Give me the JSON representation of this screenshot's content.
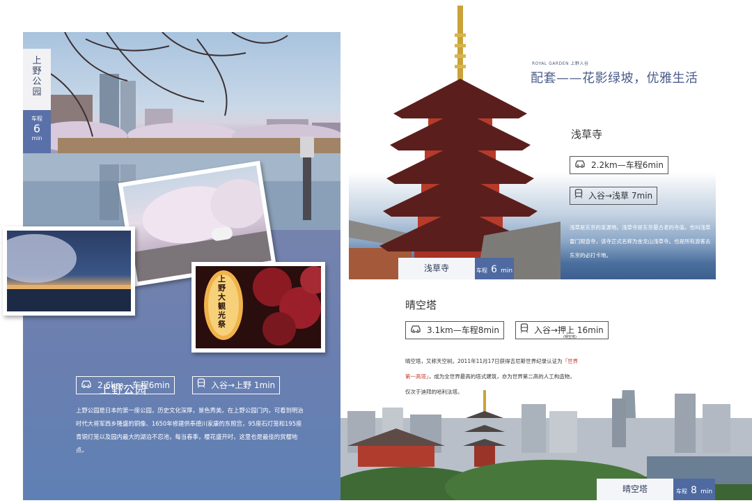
{
  "ueno": {
    "tab_name_chars": [
      "上",
      "野",
      "公",
      "园"
    ],
    "tab_time_prefix": "车程",
    "tab_time_num": "6",
    "tab_time_unit": "min",
    "title": "上野公园",
    "car_info": "2.6km—车程6min",
    "train_info": "入谷→上野 1min",
    "description": "上野公园是日本的第一座公园，历史文化深厚，景色秀美。在上野公园门内，可看到明治时代大将军西乡隆盛的铜像、1650年修建供奉德川家康的东照宫，95座石灯笼和195座青铜灯笼以及园内最大的湖泊不忍池，每当春季，樱花盛开时，这里也是最佳的赏樱地点。",
    "lantern_text": "上野大観光祭"
  },
  "asakusa": {
    "brand_tag": "ROYAL GARDEN 上野入谷",
    "slogan": "配套——花影绿坡，优雅生活",
    "title": "浅草寺",
    "car_info": "2.2km—车程6min",
    "train_info": "入谷→浅草 7min",
    "description": "浅草是东京的发源地。浅草寺是东京最古老的寺庙，也叫浅草雷门观音寺，该寺正式名称为金龙山浅草寺。也是所有游客去东京的必打卡地。",
    "tab_name": "浅草寺",
    "tab_time_prefix": "车程",
    "tab_time_num": "6",
    "tab_time_unit": "min"
  },
  "skytree": {
    "title": "晴空塔",
    "car_info": "3.1km—车程8min",
    "train_info": "入谷→押上 16min",
    "train_note": "(晴空塔)",
    "desc_before": "晴空塔，又称天空树。2011年11月17日获得吉尼斯世界纪录认证为",
    "desc_highlight": "「世界第一高塔」",
    "desc_after": "，成为全世界最高的塔式建筑，亦为世界第二高的人工构造物，仅次于迪拜的哈利法塔。",
    "tab_name": "晴空塔",
    "tab_time_prefix": "车程",
    "tab_time_num": "8",
    "tab_time_unit": "min"
  },
  "colors": {
    "panel_blue": "#6a7fb0",
    "accent_blue": "#4e6aa0",
    "highlight_red": "#c0392b"
  },
  "icons": {
    "car": "car-icon",
    "train": "train-icon"
  }
}
